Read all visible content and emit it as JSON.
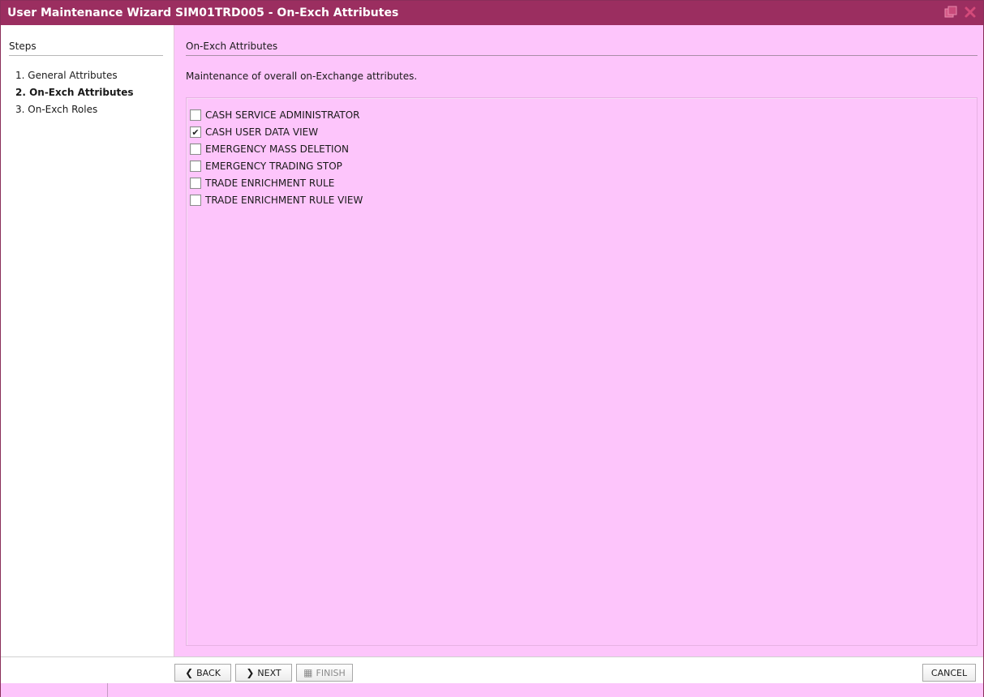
{
  "window": {
    "title": "User Maintenance Wizard SIM01TRD005 - On-Exch Attributes"
  },
  "titlebar_icons": [
    {
      "name": "restore-icon",
      "color": "#d45a87"
    },
    {
      "name": "close-icon",
      "color": "#d44a7a"
    }
  ],
  "steps": {
    "header": "Steps",
    "items": [
      {
        "label": "1. General Attributes",
        "active": false
      },
      {
        "label": "2. On-Exch Attributes",
        "active": true
      },
      {
        "label": "3. On-Exch Roles",
        "active": false
      }
    ]
  },
  "main": {
    "header": "On-Exch Attributes",
    "description": "Maintenance of overall on-Exchange attributes.",
    "options": [
      {
        "label": "CASH SERVICE ADMINISTRATOR",
        "checked": false
      },
      {
        "label": "CASH USER DATA VIEW",
        "checked": true
      },
      {
        "label": "EMERGENCY MASS DELETION",
        "checked": false
      },
      {
        "label": "EMERGENCY TRADING STOP",
        "checked": false
      },
      {
        "label": "TRADE ENRICHMENT RULE",
        "checked": false
      },
      {
        "label": "TRADE ENRICHMENT RULE VIEW",
        "checked": false
      }
    ]
  },
  "footer": {
    "back_label": "BACK",
    "next_label": "NEXT",
    "finish_label": "FINISH",
    "cancel_label": "CANCEL"
  },
  "colors": {
    "titlebar": "#9b2e60",
    "content_bg": "#fdc5fb",
    "accent": "#d45a87"
  }
}
